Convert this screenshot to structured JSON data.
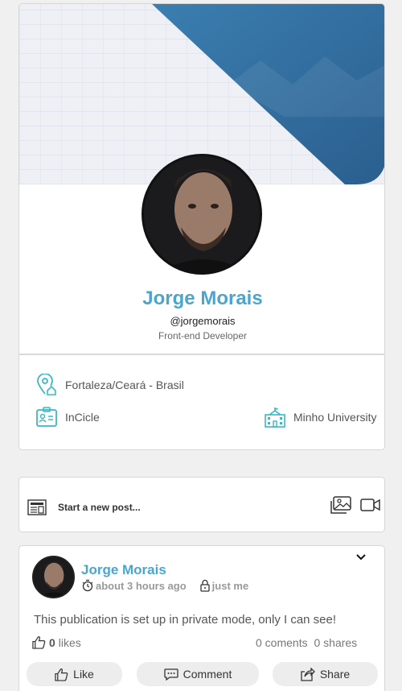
{
  "profile": {
    "name": "Jorge Morais",
    "handle": "@jorgemorais",
    "role": "Front-end Developer",
    "location": "Fortaleza/Ceará - Brasil",
    "company": "InCicle",
    "school": "Minho University"
  },
  "composer": {
    "placeholder": "Start a new post..."
  },
  "post": {
    "author": "Jorge Morais",
    "time": "about 3 hours ago",
    "visibility": "just me",
    "text": "This publication is set up in private mode, only I can see!",
    "likes_count": "0",
    "likes_label": "likes",
    "comments": "0 coments",
    "shares": "0 shares"
  },
  "actions": {
    "like": "Like",
    "comment": "Comment",
    "share": "Share"
  },
  "colors": {
    "accent": "#4ba6cf",
    "icon_teal": "#3ab8c4",
    "cover_blue": "#2f6a9a"
  }
}
